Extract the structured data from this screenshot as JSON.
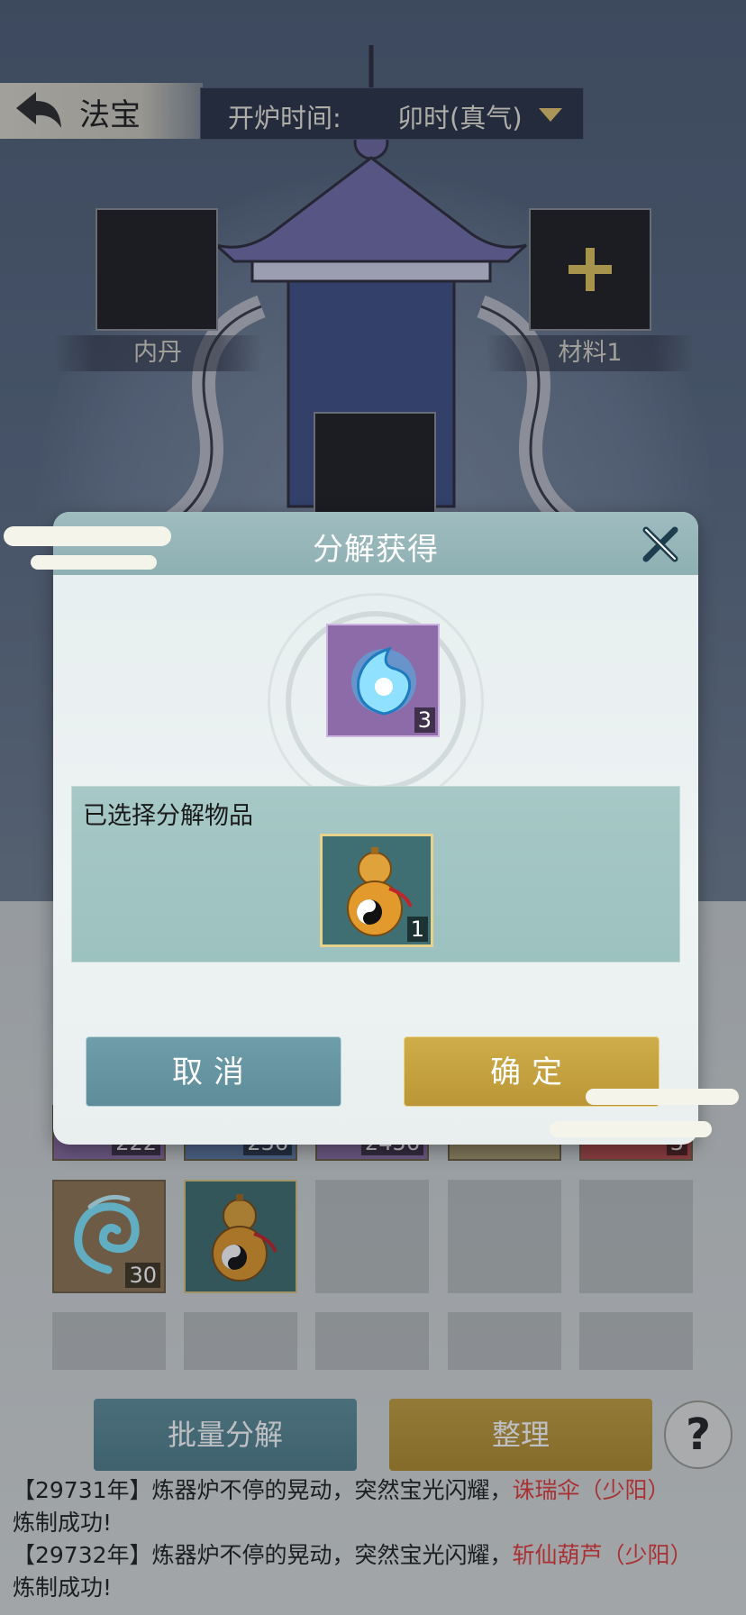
{
  "header": {
    "title": "法宝",
    "time_label": "开炉时间:",
    "time_value": "卯时(真气)"
  },
  "furnace_slots": {
    "left_label": "内丹",
    "right_label": "材料1"
  },
  "inventory": {
    "partial_counts": [
      "222",
      "236",
      "2456",
      "3"
    ],
    "items": [
      {
        "name": "spirit-essence",
        "count": "30"
      },
      {
        "name": "gourd",
        "count": ""
      }
    ]
  },
  "bottom_buttons": {
    "batch_decompose": "批量分解",
    "organize": "整理",
    "help": "?"
  },
  "log": {
    "line1_prefix": "【29731年】炼器炉不停的晃动，突然宝光闪耀，",
    "line1_item": "诛瑞伞（少阳）",
    "line1_suffix": "炼制成功!",
    "line2_prefix": "【29732年】炼器炉不停的晃动，突然宝光闪耀，",
    "line2_item": "斩仙葫芦（少阳）",
    "line2_suffix": "炼制成功!"
  },
  "dialog": {
    "title": "分解获得",
    "reward_count": "3",
    "selected_label": "已选择分解物品",
    "selected_count": "1",
    "cancel": "取消",
    "confirm": "确定"
  },
  "colors": {
    "accent_gold": "#c8a542",
    "accent_teal": "#6a98a5",
    "log_highlight": "#e23b3b"
  }
}
